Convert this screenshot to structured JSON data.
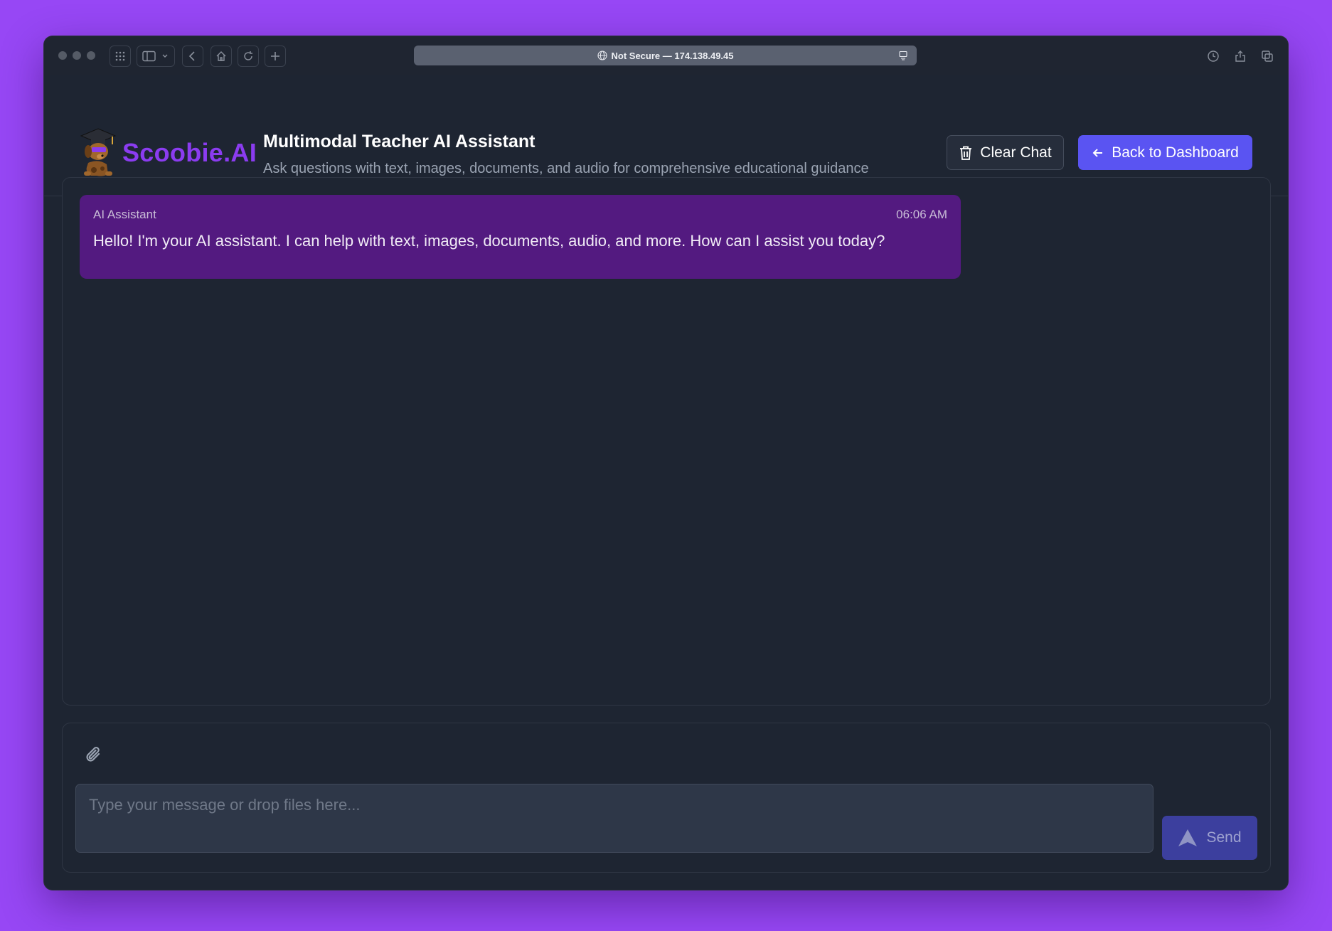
{
  "browser": {
    "address_text": "Not Secure — 174.138.49.45"
  },
  "header": {
    "logo_text": "Scoobie.AI",
    "title": "Multimodal Teacher AI Assistant",
    "subtitle": "Ask questions with text, images, documents, and audio for comprehensive educational guidance",
    "clear_label": "Clear Chat",
    "dashboard_label": "Back to Dashboard"
  },
  "chat": {
    "messages": [
      {
        "sender": "AI Assistant",
        "time": "06:06 AM",
        "text": "Hello! I'm your AI assistant. I can help with text, images, documents, audio, and more. How can I assist you today?"
      }
    ]
  },
  "composer": {
    "placeholder": "Type your message or drop files here...",
    "value": "",
    "send_label": "Send"
  },
  "colors": {
    "page_background": "#9747f5",
    "app_background": "#1e2532",
    "brand": "#8b3cf0",
    "primary_button": "#5a54f2",
    "assistant_bubble": "#531a80",
    "send_button_disabled": "#3c3f9e"
  },
  "icons": {
    "clear": "trash-icon",
    "dashboard": "arrow-left-icon",
    "attach": "paperclip-icon",
    "send": "send-icon"
  }
}
